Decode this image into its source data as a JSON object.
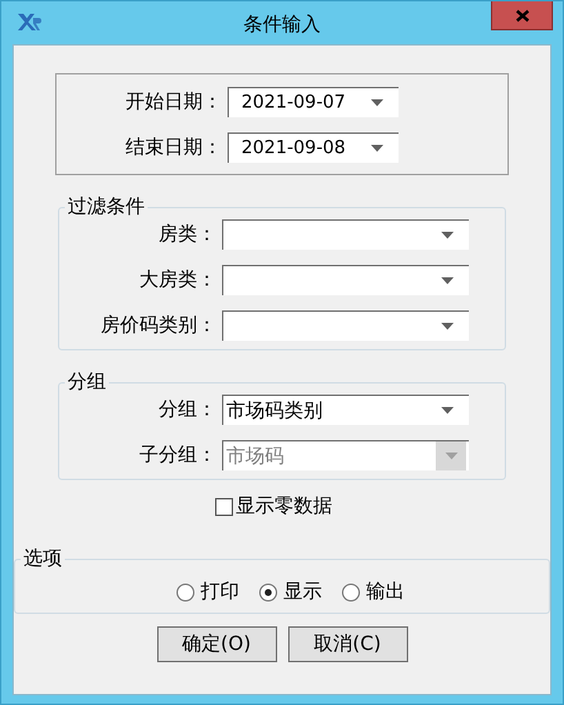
{
  "window": {
    "title": "条件输入"
  },
  "date_range": {
    "fields": [
      {
        "label": "开始日期：",
        "value": "2021-09-07"
      },
      {
        "label": "结束日期：",
        "value": "2021-09-08"
      }
    ]
  },
  "filter": {
    "title": "过滤条件",
    "fields": [
      {
        "label": "房类：",
        "disabled": false
      },
      {
        "label": "大房类：",
        "disabled": false
      },
      {
        "label": "房价码类别：",
        "disabled": false
      }
    ]
  },
  "grouping": {
    "title": "分组",
    "fields": [
      {
        "label": "分组：",
        "value": "市场码类别",
        "disabled": false
      },
      {
        "label": "子分组：",
        "value": "市场码",
        "disabled": true
      }
    ]
  },
  "show_zero": {
    "label": "显示零数据",
    "checked": false
  },
  "options": {
    "title": "选项",
    "radios": [
      {
        "label": "打印",
        "selected": false
      },
      {
        "label": "显示",
        "selected": true
      },
      {
        "label": "输出",
        "selected": false
      }
    ]
  },
  "buttons": [
    {
      "label": "确定(O)"
    },
    {
      "label": "取消(C)"
    }
  ]
}
